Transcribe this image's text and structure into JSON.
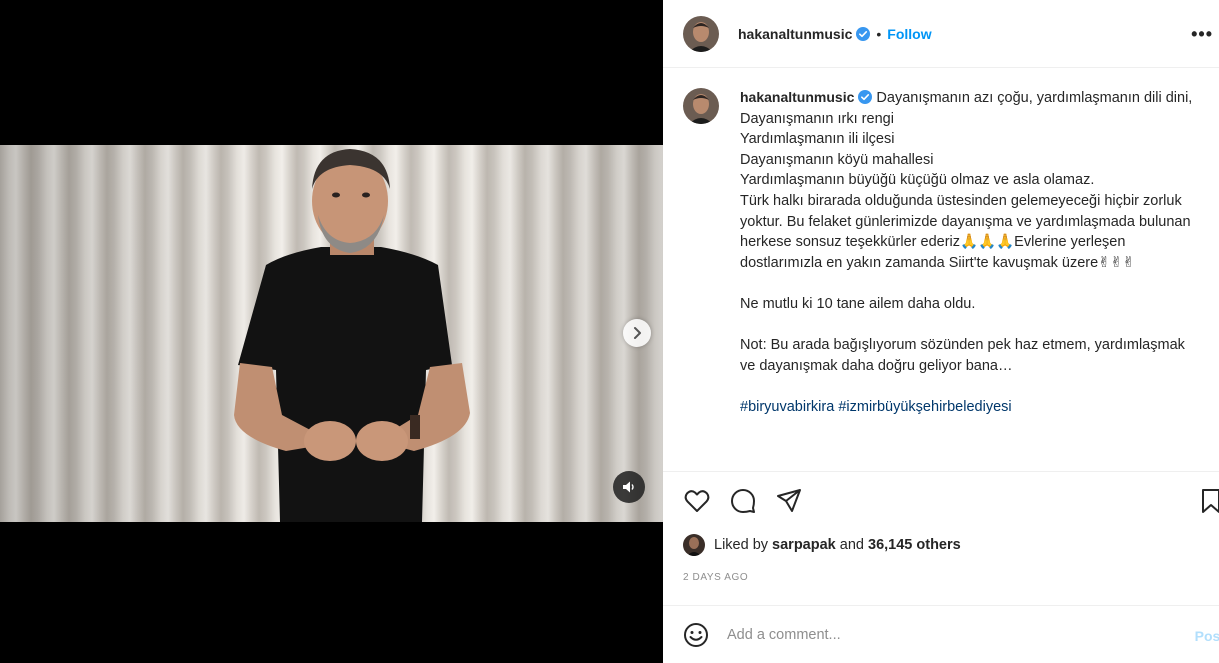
{
  "post": {
    "username": "hakanaltunmusic",
    "follow_label": "Follow",
    "separator": "•",
    "more_label": "•••",
    "verified_icon": "verified-badge-icon",
    "carousel": {
      "slide_count": 2,
      "active_slide": 1
    }
  },
  "caption": {
    "username": "hakanaltunmusic",
    "lines": [
      "Dayanışmanın azı çoğu, yardımlaşmanın dili dini,",
      "Dayanışmanın ırkı rengi",
      "Yardımlaşmanın ili ilçesi",
      "Dayanışmanın köyü mahallesi",
      "Yardımlaşmanın büyüğü küçüğü olmaz ve asla olamaz.",
      "Türk halkı birarada olduğunda üstesinden gelemeyeceği hiçbir zorluk yoktur. Bu felaket günlerimizde dayanışma ve yardımlaşmada bulunan herkese sonsuz teşekkürler ederiz🙏🙏🙏Evlerine yerleşen dostlarımızla en yakın zamanda Siirt'te kavuşmak üzere✌✌✌"
    ],
    "para2": "Ne mutlu ki 10 tane ailem daha oldu.",
    "para3": "Not: Bu arada bağışlıyorum sözünden pek haz etmem, yardımlaşmak ve dayanışmak daha doğru geliyor bana…",
    "hashtag1": "#biryuvabirkira",
    "hashtag2": "#izmirbüyükşehirbelediyesi"
  },
  "likes": {
    "prefix": "Liked by",
    "user": "sarpapak",
    "middle": "and",
    "others": "36,145 others"
  },
  "date": "2 DAYS AGO",
  "comment": {
    "placeholder": "Add a comment...",
    "post_label": "Post"
  },
  "colors": {
    "accent": "#0095f6",
    "verified": "#3897f0",
    "hashtag": "#00376b"
  }
}
